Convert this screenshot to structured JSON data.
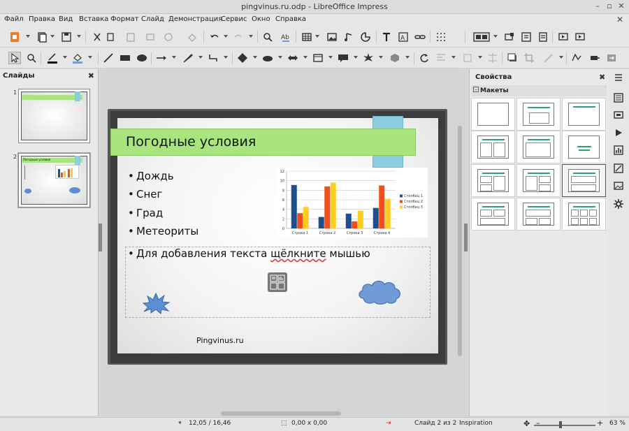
{
  "window": {
    "title": "pingvinus.ru.odp - LibreOffice Impress"
  },
  "menu": [
    "Файл",
    "Правка",
    "Вид",
    "Вставка",
    "Формат",
    "Слайд",
    "Демонстрация",
    "Сервис",
    "Окно",
    "Справка"
  ],
  "slides_panel": {
    "title": "Слайды",
    "thumbs": [
      {
        "num": "1"
      },
      {
        "num": "2",
        "title": "Погодные условия"
      }
    ]
  },
  "slide": {
    "title": "Погодные условия",
    "bullets": [
      "Дождь",
      "Снег",
      "Град",
      "Метеориты"
    ],
    "placeholder": "Для добавления текста щёлкните мышью",
    "placeholder_word": "щёлкните",
    "placeholder_before": "Для добавления текста ",
    "placeholder_after": " мышью",
    "footer": "Pingvinus.ru"
  },
  "chart_data": {
    "type": "bar",
    "categories": [
      "Строка 1",
      "Строка 2",
      "Строка 3",
      "Строка 4"
    ],
    "series": [
      {
        "name": "Столбец 1",
        "color": "#1f4e8c",
        "values": [
          9.1,
          2.4,
          3.1,
          4.3
        ]
      },
      {
        "name": "Столбец 2",
        "color": "#f04e1b",
        "values": [
          3.2,
          8.8,
          1.5,
          9.0
        ]
      },
      {
        "name": "Столбец 3",
        "color": "#ffcc22",
        "values": [
          4.5,
          9.6,
          3.7,
          6.2
        ]
      }
    ],
    "ylim": [
      0,
      12
    ],
    "yticks": [
      "0",
      "2",
      "4",
      "6",
      "8",
      "10",
      "12"
    ],
    "legend": "right",
    "grid": true
  },
  "sidebar": {
    "title": "Свойства",
    "section": "Макеты"
  },
  "status": {
    "position": "12,05 / 16,46",
    "size": "0,00 x 0,00",
    "slide": "Слайд 2 из 2",
    "master": "Inspiration",
    "zoom": "63 %",
    "zoom_level": 0.43
  },
  "colors": {
    "title_band": "#a9e57e",
    "title_tab": "#8ccde0",
    "shape_blue": "#5b8fd1"
  }
}
